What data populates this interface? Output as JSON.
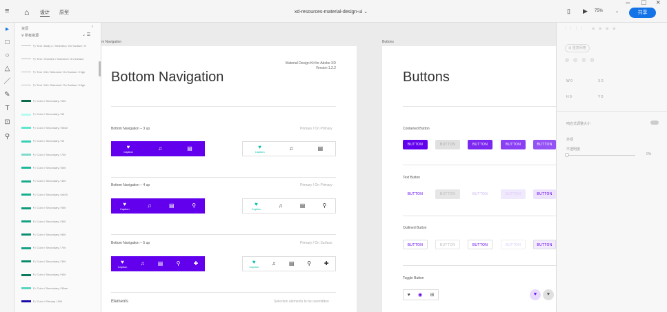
{
  "titlebar": {
    "tabs": [
      "设计",
      "原型"
    ],
    "document_title": "xd-resources-material-design-ui ⌄",
    "zoom": "75%",
    "share_label": "共享",
    "window_controls": [
      "–",
      "□",
      "×"
    ]
  },
  "assets_panel": {
    "header": "资源",
    "search_placeholder": "所有资源",
    "text_styles": [
      "¶ / Text / Body 2 / Selected / On Surface / H",
      "¶ / Text / Overline / Selected / On Surface",
      "¶ / Text / H6 / Selected / On Surface / High",
      "¶ / Text / H6 / Selected / On Surface / High"
    ],
    "colors": [
      {
        "label": "¶ / Color / Secondary / 900",
        "color": "#0b6b4a"
      },
      {
        "label": "¶ / Color / Secondary / 50",
        "color": "#b3fbef"
      },
      {
        "label": "¶ / Color / Secondary / 50wn",
        "color": "#5fe6cd"
      },
      {
        "label": "¶ / Color / Secondary / 90",
        "color": "#35d0b6"
      },
      {
        "label": "¶ / Color / Secondary / 700",
        "color": "#7adcc9"
      },
      {
        "label": "¶ / Color / Secondary / 600",
        "color": "#1db89a"
      },
      {
        "label": "¶ / Color / Secondary / 400",
        "color": "#1aa98c"
      },
      {
        "label": "¶ / Color / Secondary / A400",
        "color": "#12b08f"
      },
      {
        "label": "¶ / Color / Secondary / 900",
        "color": "#0f9a7b"
      },
      {
        "label": "¶ / Color / Secondary / 500",
        "color": "#13a183"
      },
      {
        "label": "¶ / Color / Secondary / 800",
        "color": "#0c8d70"
      },
      {
        "label": "¶ / Color / Secondary / 700",
        "color": "#14a386"
      },
      {
        "label": "¶ / Color / Secondary / 300",
        "color": "#0b8a6b"
      },
      {
        "label": "¶ / Color / Secondary / 900",
        "color": "#097a5e"
      },
      {
        "label": "¶ / Color / Secondary / 50wn",
        "color": "#58d6bd"
      },
      {
        "label": "¶ / Color / Primary / 900",
        "color": "#1a0aa8"
      },
      {
        "label": "¶ / Color / Primary / 50",
        "color": "#e9ddfb"
      }
    ]
  },
  "canvas": {
    "bottom_nav_board": {
      "label": "m Navigation",
      "title": "Bottom Navigation",
      "meta_line1": "Material Design Kit for Adobe XD",
      "meta_line2": "Version 1.2.2",
      "sections": [
        {
          "title": "Bottom Navigation – 3 up",
          "hint": "Primary / On Primary"
        },
        {
          "title": "Bottom Navigation – 4 up",
          "hint": "Primary / On Primary"
        },
        {
          "title": "Bottom Navigation – 5 up",
          "hint": "Primary / On Surface"
        }
      ],
      "caption": "Caption",
      "elements_title": "Elements",
      "elements_hint": "Selection elements to be overridden"
    },
    "buttons_board": {
      "label": "Buttons",
      "title": "Buttons",
      "sections": [
        "Contained Button",
        "Text Button",
        "Outlined Button",
        "Toggle Button"
      ],
      "button_text": "BUTTON"
    }
  },
  "properties_panel": {
    "repeat_grid": "重复网格",
    "w_label": "W 0",
    "x_label": "X 0",
    "h_label": "H 0",
    "y_label": "Y 0",
    "responsive": "响应式调整大小",
    "appearance": "外观",
    "opacity_label": "不透明度",
    "opacity_value": "0%"
  },
  "colors": {
    "primary": "#6200ee",
    "secondary": "#00bfa5",
    "accent": "#1473e6"
  }
}
